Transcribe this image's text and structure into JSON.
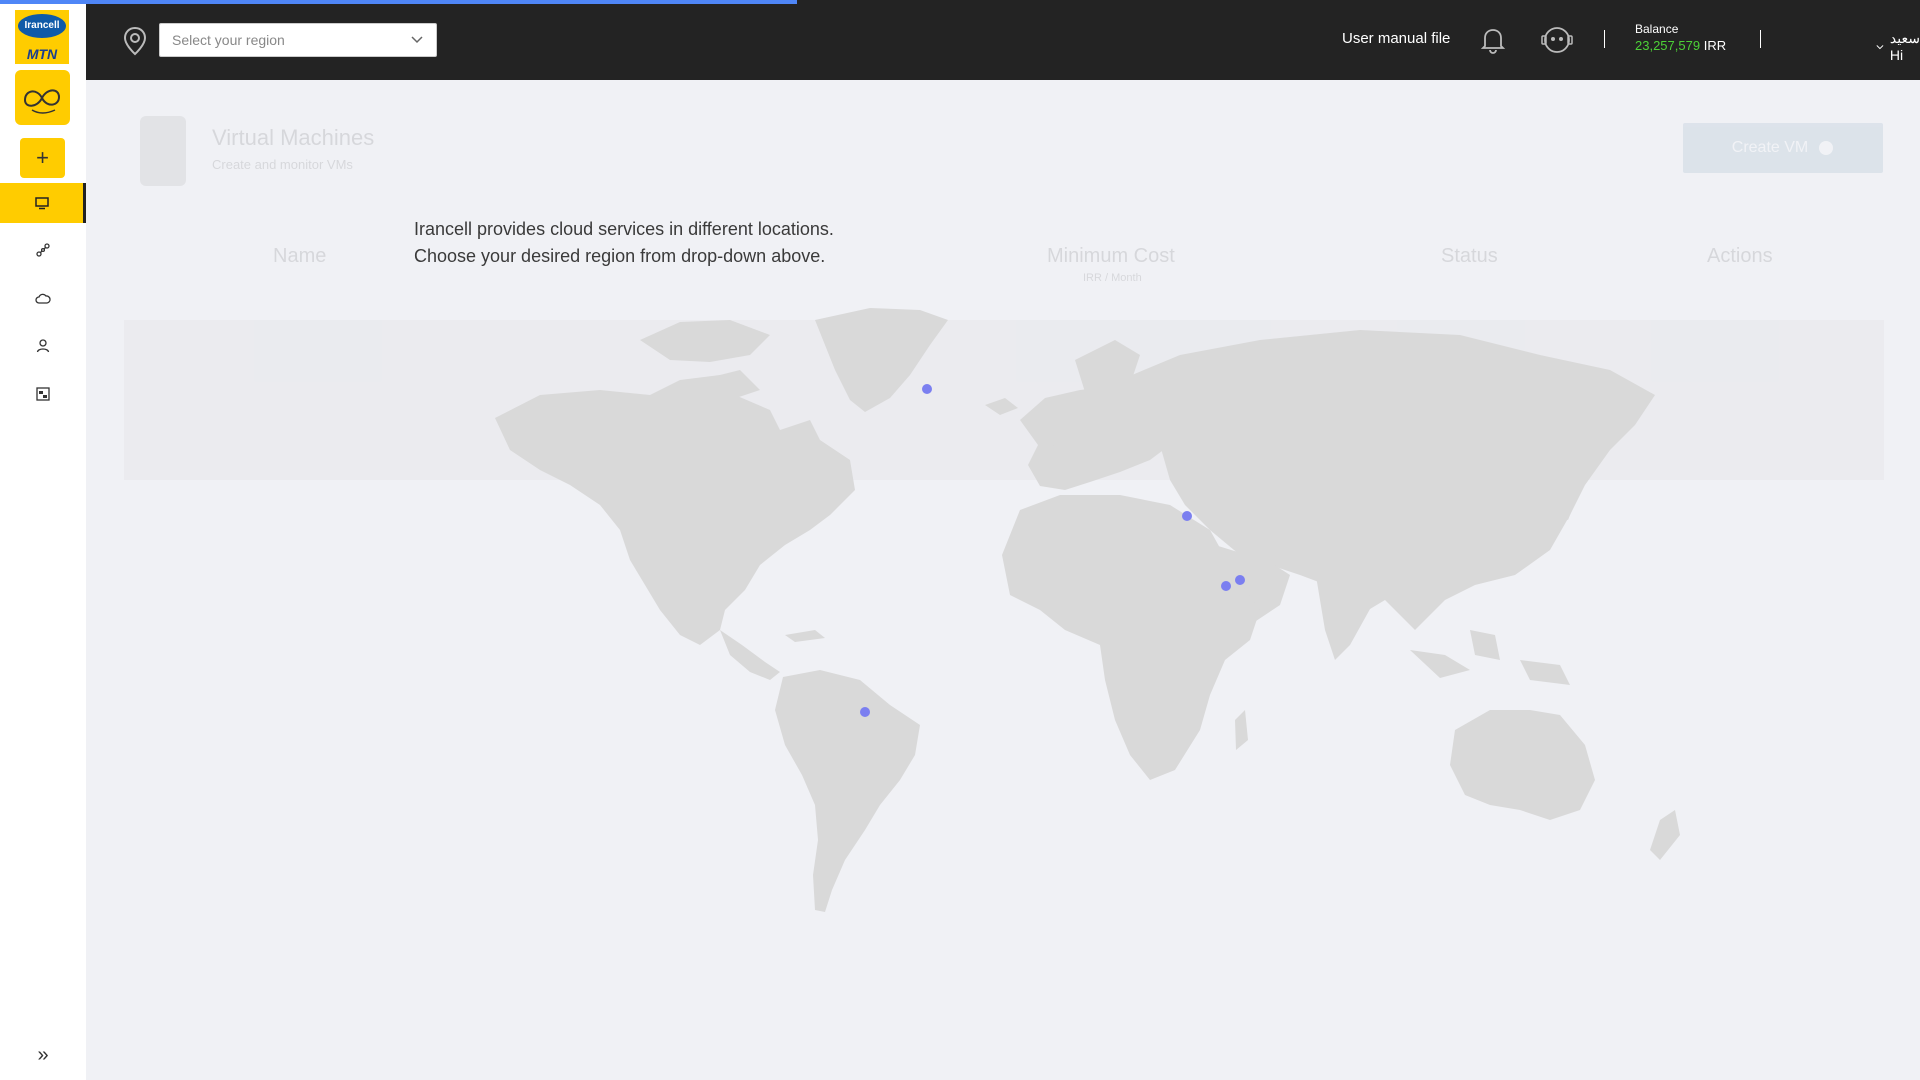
{
  "top_progress": {
    "fraction": 0.415
  },
  "sidebar": {
    "logo": {
      "brand": "Irancell",
      "sub": "MTN"
    },
    "add_label": "+",
    "items": [
      {
        "icon": "monitor-icon",
        "active": true
      },
      {
        "icon": "network-icon",
        "active": false
      },
      {
        "icon": "cloud-icon",
        "active": false
      },
      {
        "icon": "user-icon",
        "active": false
      },
      {
        "icon": "image-icon",
        "active": false
      }
    ],
    "collapse_label": "»"
  },
  "topbar": {
    "region_placeholder": "Select your region",
    "manual_label": "User manual file",
    "balance_label": "Balance",
    "balance_value": "23,257,579",
    "balance_currency": "IRR",
    "user_greeting": "سیدسعید Hi"
  },
  "page": {
    "title": "Virtual Machines",
    "subtitle": "Create and monitor VMs",
    "create_button": "Create VM",
    "columns": {
      "name": "Name",
      "min_cost": "Minimum Cost",
      "min_cost_unit": "IRR / Month",
      "status": "Status",
      "actions": "Actions"
    }
  },
  "info": {
    "line1": "Irancell provides cloud services in different locations.",
    "line2": "Choose your desired region from drop-down above."
  },
  "map": {
    "land_color": "#d9d9d9",
    "marker_color": "#7b7ff0",
    "markers": [
      {
        "name": "greenland"
      },
      {
        "name": "europe"
      },
      {
        "name": "iran-west"
      },
      {
        "name": "iran-east"
      },
      {
        "name": "south-america"
      }
    ]
  }
}
